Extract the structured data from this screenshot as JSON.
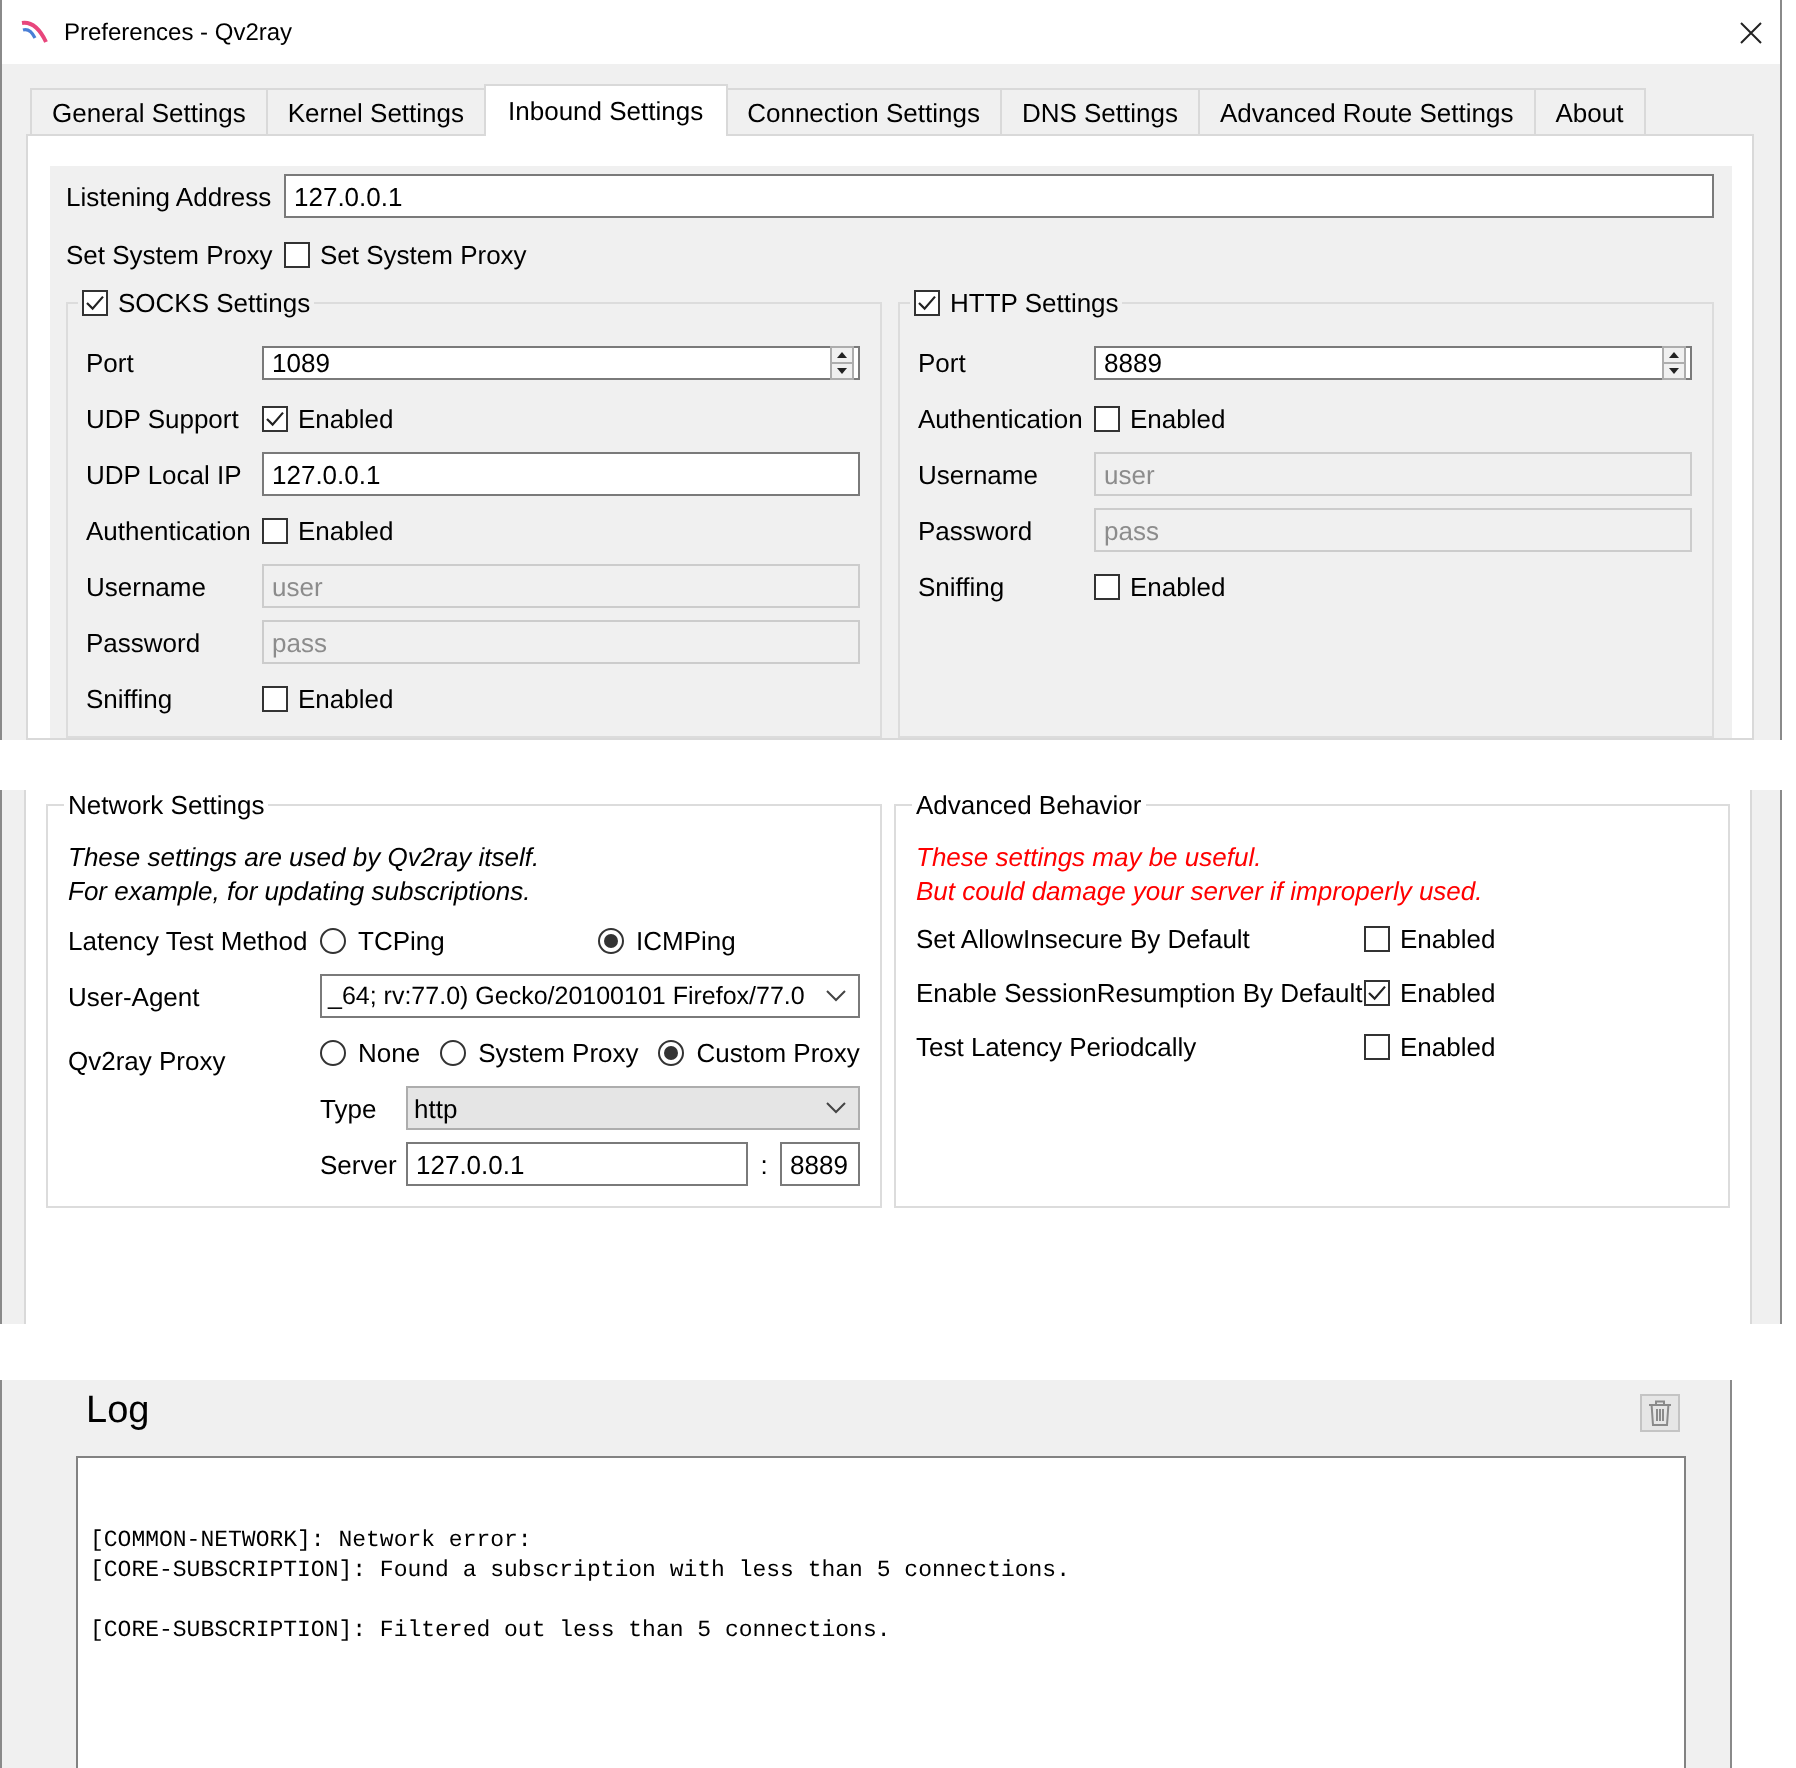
{
  "window": {
    "title": "Preferences - Qv2ray"
  },
  "tabs": [
    {
      "label": "General Settings",
      "selected": false
    },
    {
      "label": "Kernel Settings",
      "selected": false
    },
    {
      "label": "Inbound Settings",
      "selected": true
    },
    {
      "label": "Connection Settings",
      "selected": false
    },
    {
      "label": "DNS Settings",
      "selected": false
    },
    {
      "label": "Advanced Route Settings",
      "selected": false
    },
    {
      "label": "About",
      "selected": false
    }
  ],
  "inbound": {
    "listening_address": {
      "label": "Listening Address",
      "value": "127.0.0.1"
    },
    "system_proxy": {
      "label": "Set System Proxy",
      "checkbox_label": "Set System Proxy",
      "checked": false
    },
    "groups": [
      {
        "title": "SOCKS Settings",
        "checked": true,
        "rows": [
          {
            "kind": "spinbox",
            "label": "Port",
            "value": "1089",
            "disabled": false
          },
          {
            "kind": "checkbox",
            "label": "UDP Support",
            "text": "Enabled",
            "checked": true,
            "disabled": false
          },
          {
            "kind": "input",
            "label": "UDP Local IP",
            "value": "127.0.0.1",
            "disabled": false
          },
          {
            "kind": "checkbox",
            "label": "Authentication",
            "text": "Enabled",
            "checked": false,
            "disabled": false
          },
          {
            "kind": "input",
            "label": "Username",
            "placeholder": "user",
            "disabled": true
          },
          {
            "kind": "input",
            "label": "Password",
            "placeholder": "pass",
            "disabled": true
          },
          {
            "kind": "checkbox",
            "label": "Sniffing",
            "text": "Enabled",
            "checked": false,
            "disabled": false
          }
        ]
      },
      {
        "title": "HTTP Settings",
        "checked": true,
        "rows": [
          {
            "kind": "spinbox",
            "label": "Port",
            "value": "8889",
            "disabled": false
          },
          {
            "kind": "checkbox",
            "label": "Authentication",
            "text": "Enabled",
            "checked": false,
            "disabled": false
          },
          {
            "kind": "input",
            "label": "Username",
            "placeholder": "user",
            "disabled": true
          },
          {
            "kind": "input",
            "label": "Password",
            "placeholder": "pass",
            "disabled": true
          },
          {
            "kind": "checkbox",
            "label": "Sniffing",
            "text": "Enabled",
            "checked": false,
            "disabled": false
          }
        ]
      }
    ]
  },
  "network": {
    "title": "Network Settings",
    "notes": [
      "These settings are used by Qv2ray itself.",
      "For example, for updating subscriptions."
    ],
    "latency_test_method": {
      "label": "Latency Test Method",
      "options": [
        {
          "label": "TCPing",
          "selected": false
        },
        {
          "label": "ICMPing",
          "selected": true
        }
      ]
    },
    "user_agent": {
      "label": "User-Agent",
      "value": "_64; rv:77.0) Gecko/20100101 Firefox/77.0"
    },
    "qv2ray_proxy": {
      "label": "Qv2ray Proxy",
      "options": [
        {
          "label": "None",
          "selected": false
        },
        {
          "label": "System Proxy",
          "selected": false
        },
        {
          "label": "Custom Proxy",
          "selected": true
        }
      ],
      "type": {
        "label": "Type",
        "value": "http"
      },
      "server": {
        "label": "Server",
        "host": "127.0.0.1",
        "separator": ":",
        "port": "8889"
      }
    }
  },
  "advanced": {
    "title": "Advanced Behavior",
    "warnings": [
      "These settings may be useful.",
      "But could damage your server if improperly used."
    ],
    "rows": [
      {
        "label": "Set AllowInsecure By Default",
        "text": "Enabled",
        "checked": false
      },
      {
        "label": "Enable SessionResumption By Default",
        "text": "Enabled",
        "checked": true
      },
      {
        "label": "Test Latency Periodcally",
        "text": "Enabled",
        "checked": false
      }
    ]
  },
  "log": {
    "title": "Log",
    "paragraphs": [
      [
        "[COMMON-NETWORK]: Network error:",
        "[CORE-SUBSCRIPTION]: Found a subscription with less than 5 connections."
      ],
      [
        "[CORE-SUBSCRIPTION]: Filtered out less than 5 connections."
      ]
    ]
  }
}
